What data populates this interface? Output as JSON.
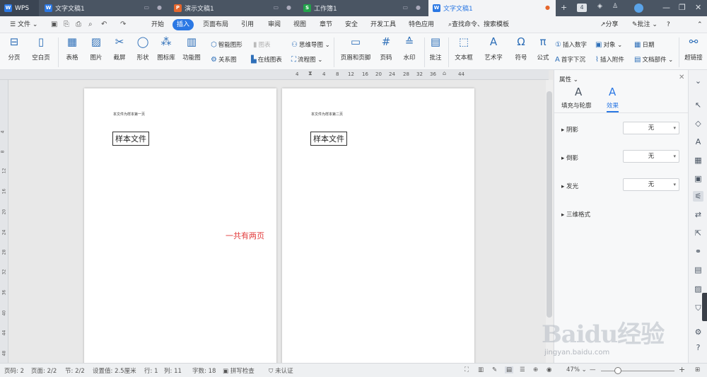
{
  "tabs": [
    {
      "label": "WPS"
    },
    {
      "label": "文字文稿1",
      "icon": "W"
    },
    {
      "label": "演示文稿1",
      "icon": "P"
    },
    {
      "label": "工作簿1",
      "icon": "S"
    },
    {
      "label": "文字文稿1",
      "icon": "W"
    }
  ],
  "tab_badge": "4",
  "menu": {
    "file": "文件",
    "items": [
      "开始",
      "插入",
      "页面布局",
      "引用",
      "审阅",
      "视图",
      "章节",
      "安全",
      "开发工具",
      "特色应用"
    ],
    "active": "插入",
    "search": "查找命令、搜索模板",
    "share": "分享",
    "comment": "批注",
    "help": "?"
  },
  "ribbon": {
    "items": [
      "分页",
      "空白页",
      "表格",
      "图片",
      "截屏",
      "形状",
      "图标库",
      "功能图"
    ],
    "small": [
      "智能图形",
      "图表",
      "关系图",
      "在线图表",
      "思维导图",
      "流程图"
    ],
    "items2": [
      "页眉和页脚",
      "页码",
      "水印",
      "批注",
      "文本框",
      "艺术字",
      "符号",
      "公式"
    ],
    "small2": [
      "插入数字",
      "对象",
      "日期",
      "首字下沉",
      "插入附件",
      "文档部件"
    ],
    "more": "超链接"
  },
  "ruler": {
    "h": [
      "4",
      "4",
      "8",
      "12",
      "16",
      "20",
      "24",
      "28",
      "32",
      "36",
      "44"
    ],
    "v": [
      "4",
      "8",
      "12",
      "16",
      "20",
      "24",
      "28",
      "32",
      "36",
      "40",
      "44",
      "48"
    ]
  },
  "doc": {
    "page1": {
      "header": "本文件为样本第一页",
      "box": "样本文件"
    },
    "page2": {
      "header": "本文件为样本第二页",
      "box": "样本文件"
    },
    "annotation": "一共有两页"
  },
  "panel": {
    "title": "属性",
    "tab1": "填充与轮廓",
    "tab2": "效果",
    "rows": [
      {
        "label": "阴影",
        "value": "无"
      },
      {
        "label": "倒影",
        "value": "无"
      },
      {
        "label": "发光",
        "value": "无"
      },
      {
        "label": "三维格式"
      }
    ]
  },
  "status": {
    "page": "页码: 2",
    "pages": "页面: 2/2",
    "section": "节: 2/2",
    "setting": "设置值: 2.5厘米",
    "row": "行: 1",
    "col": "列: 11",
    "words": "字数: 18",
    "spell": "拼写检查",
    "cert": "未认证",
    "zoom": "47%"
  },
  "watermark": {
    "main": "Baidu经验",
    "sub": "jingyan.baidu.com"
  },
  "colors": {
    "accent": "#2b78e4",
    "tabbar": "#4a5563",
    "annotation": "#e23b3b"
  }
}
